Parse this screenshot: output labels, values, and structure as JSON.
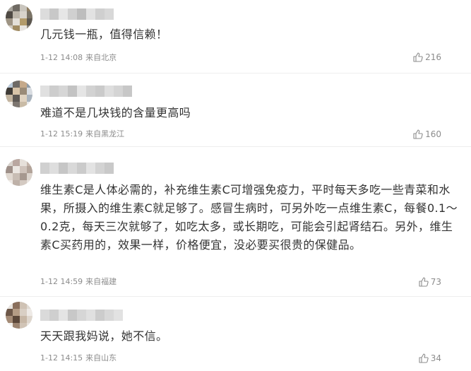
{
  "comments": [
    {
      "text": "几元钱一瓶，值得信赖！",
      "time": "1-12 14:08",
      "location": "来自北京",
      "likes": "216",
      "avatar_colors": [
        "#a7a39b",
        "#6f6a63",
        "#c9c5bd",
        "#8c7b5e",
        "#4f4a44",
        "#bdb6aa",
        "#d8d3cb",
        "#7a7366",
        "#9e9484",
        "#e3dfd8",
        "#b39b6a",
        "#5c574f",
        "#cfc8bc",
        "#a08b62",
        "#e8e5e0",
        "#8e877a"
      ],
      "username_colors": [
        "#dcdcdc",
        "#c8c8c8",
        "#e6e6e6",
        "#d0d0d0",
        "#bdbdbd",
        "#e2e2e2",
        "#cfcfcf",
        "#d8d8d8"
      ]
    },
    {
      "text": "难道不是几块钱的含量更高吗",
      "time": "1-12 15:19",
      "location": "来自黑龙江",
      "likes": "160",
      "avatar_colors": [
        "#b8c7d6",
        "#6e6a66",
        "#c5a98a",
        "#8f9ca8",
        "#3f3b37",
        "#d7c3a8",
        "#9a8b78",
        "#d9dde2",
        "#c2b49f",
        "#5d5854",
        "#e0d3c1",
        "#a9b3bd",
        "#f0ebe4",
        "#7d7670",
        "#c9bba6",
        "#e7e9ec"
      ],
      "username_colors": [
        "#e0e0e0",
        "#cdcdcd",
        "#d6d6d6",
        "#c3c3c3",
        "#e5e5e5",
        "#d2d2d2",
        "#cacaca",
        "#dedede",
        "#d4d4d4",
        "#c7c7c7"
      ]
    },
    {
      "text": "维生素C是人体必需的，补充维生素C可增强免疫力，平时每天多吃一些青菜和水果，所摄入的维生素C就足够了。感冒生病时，可另外吃一点维生素C，每餐0.1～0.2克，每天三次就够了，如吃太多，或长期吃，可能会引起肾结石。另外，维生素C买药用的，效果一样，价格便宜，没必要买很贵的保健品。",
      "time": "1-12 14:59",
      "location": "来自福建",
      "likes": "73",
      "avatar_colors": [
        "#d8d2cc",
        "#b9a7a0",
        "#e6e0da",
        "#c4b4aa",
        "#9e8f88",
        "#ebe6e1",
        "#cfc3bb",
        "#b2a399",
        "#e0d8d0",
        "#c8bdb4",
        "#a6988f",
        "#dcd4cd",
        "#efeae6",
        "#beb1a8",
        "#d4cac2",
        "#e9e3de"
      ],
      "username_colors": [
        "#d0d0d0",
        "#dedede",
        "#c6c6c6",
        "#d9d9d9",
        "#cbcbcb",
        "#e3e3e3",
        "#d3d3d3",
        "#c9c9c9"
      ]
    },
    {
      "text": "天天跟我妈说，她不信。",
      "time": "1-12 14:15",
      "location": "来自山东",
      "likes": "34",
      "avatar_colors": [
        "#e7e3de",
        "#8a6f5c",
        "#cfc2b4",
        "#e0dad3",
        "#6d5748",
        "#b49c85",
        "#d9cfc4",
        "#eeeae6",
        "#a48b76",
        "#5b4739",
        "#c7b7a6",
        "#ded6cd",
        "#f2efeb",
        "#9c8470",
        "#d1c4b6",
        "#e8e2dc"
      ],
      "username_colors": [
        "#dadada",
        "#cfcfcf",
        "#e4e4e4",
        "#c8c8c8",
        "#d6d6d6",
        "#e0e0e0",
        "#cccccc",
        "#d8d8d8",
        "#e2e2e2"
      ]
    }
  ],
  "icons": {
    "like": "thumb-up-icon"
  }
}
